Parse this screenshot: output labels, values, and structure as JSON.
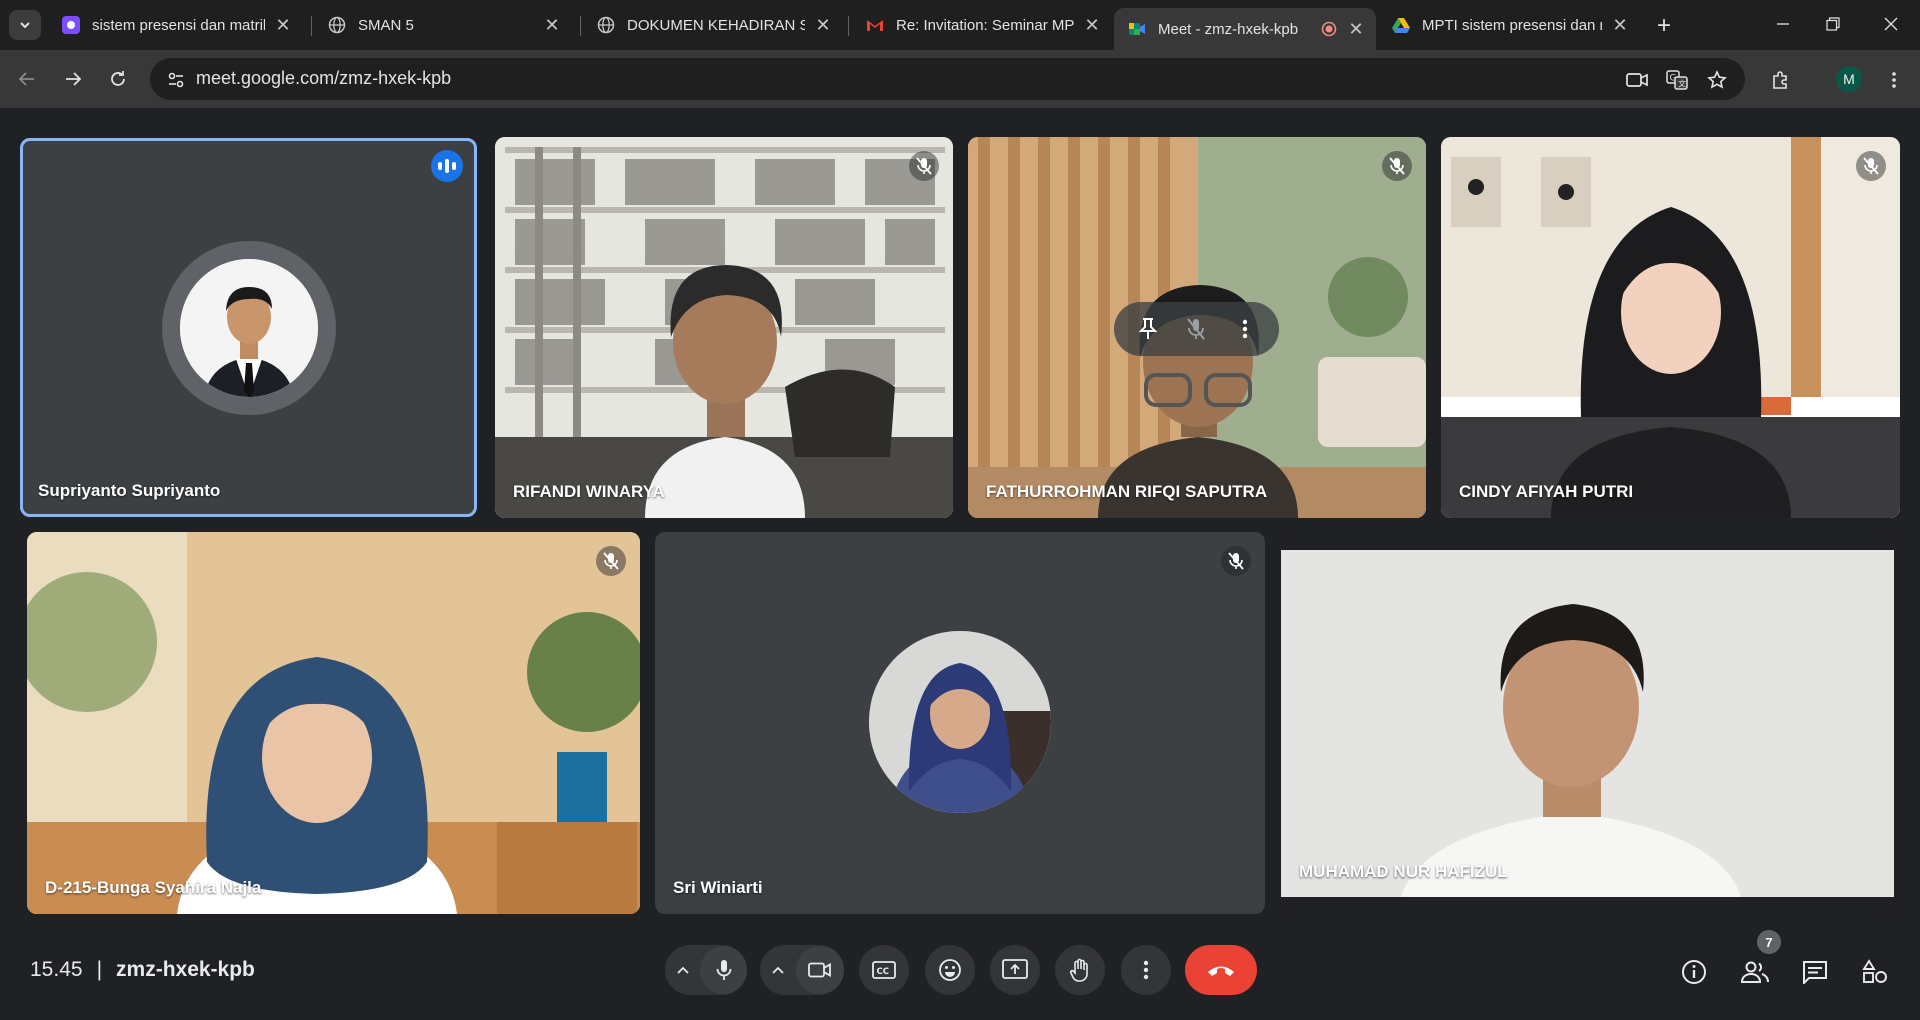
{
  "tabs": [
    {
      "title": "sistem presensi dan matrik",
      "favicon": "app-icon",
      "color": "#7c4dff"
    },
    {
      "title": "SMAN 5",
      "favicon": "globe-icon",
      "color": "#9aa0a6"
    },
    {
      "title": "DOKUMEN KEHADIRAN SI",
      "favicon": "globe-icon",
      "color": "#9aa0a6"
    },
    {
      "title": "Re: Invitation: Seminar MPT",
      "favicon": "gmail-icon",
      "color": "#ea4335"
    },
    {
      "title": "Meet - zmz-hxek-kpb",
      "favicon": "meet-icon",
      "color": "#00897b",
      "active": true
    },
    {
      "title": "MPTI sistem presensi dan r",
      "favicon": "drive-icon",
      "color": "#fbbc04"
    }
  ],
  "new_tab_label": "+",
  "url": "meet.google.com/zmz-hxek-kpb",
  "profile_initial": "M",
  "participants": [
    {
      "name": "Supriyanto Supriyanto"
    },
    {
      "name": "RIFANDI WINARYA"
    },
    {
      "name": "FATHURROHMAN RIFQI SAPUTRA"
    },
    {
      "name": "CINDY AFIYAH PUTRI"
    },
    {
      "name": "D-215-Bunga Syahira Najla"
    },
    {
      "name": "Sri Winiarti"
    },
    {
      "name": "MUHAMAD NUR HAFIZUL"
    }
  ],
  "meeting": {
    "time": "15.45",
    "separator": "|",
    "code": "zmz-hxek-kpb",
    "people_count": "7"
  },
  "colors": {
    "accent": "#8ab4f8",
    "end_call": "#ea4335",
    "speaking": "#1a73e8"
  }
}
